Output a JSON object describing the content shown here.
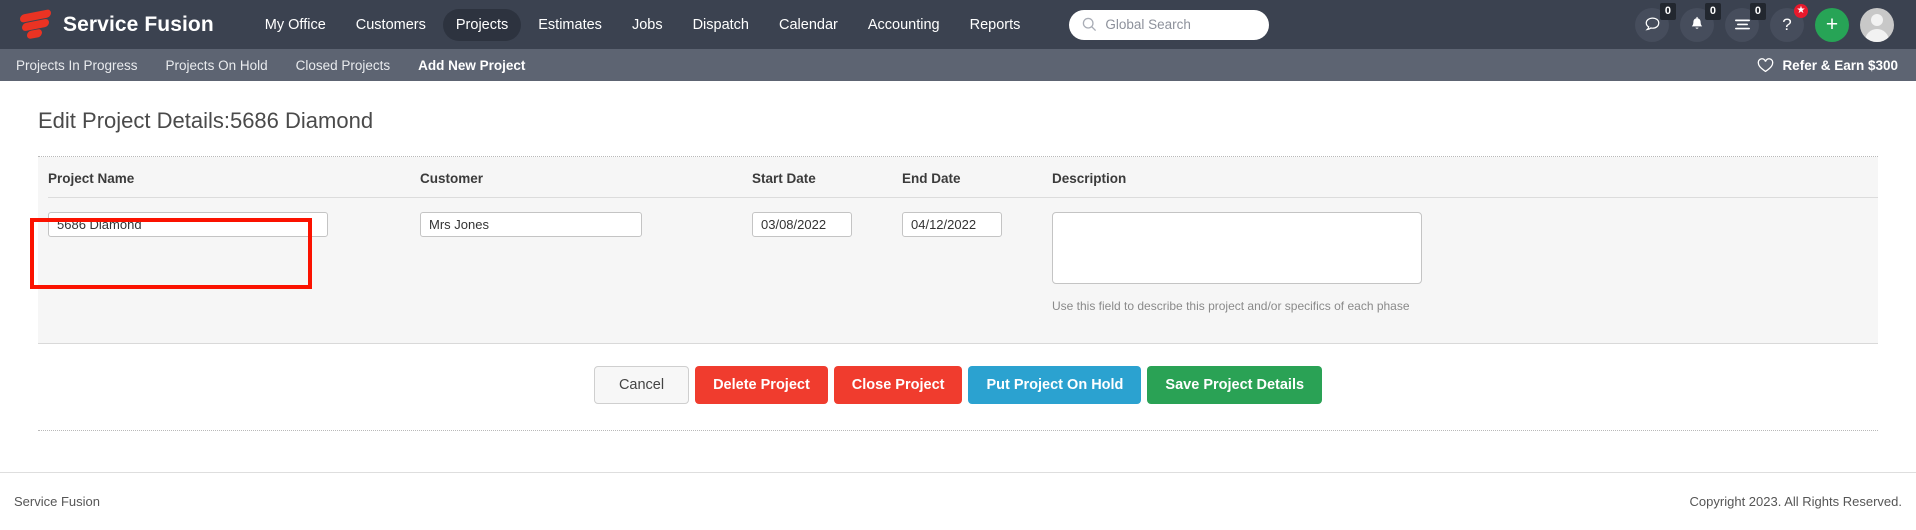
{
  "topbar": {
    "brand": "Service Fusion",
    "brand_logo_icon": "service-fusion-logo",
    "nav": [
      {
        "label": "My Office",
        "active": false
      },
      {
        "label": "Customers",
        "active": false
      },
      {
        "label": "Projects",
        "active": true
      },
      {
        "label": "Estimates",
        "active": false
      },
      {
        "label": "Jobs",
        "active": false
      },
      {
        "label": "Dispatch",
        "active": false
      },
      {
        "label": "Calendar",
        "active": false
      },
      {
        "label": "Accounting",
        "active": false
      },
      {
        "label": "Reports",
        "active": false
      }
    ],
    "search": {
      "placeholder": "Global Search",
      "value": ""
    },
    "icons": {
      "chat_badge": "0",
      "bell_badge": "0",
      "list_badge": "0",
      "help_label": "?",
      "plus_label": "+"
    }
  },
  "subbar": {
    "items": [
      {
        "label": "Projects In Progress",
        "active": false
      },
      {
        "label": "Projects On Hold",
        "active": false
      },
      {
        "label": "Closed Projects",
        "active": false
      },
      {
        "label": "Add New Project",
        "active": true
      }
    ],
    "refer_label": "Refer & Earn $300"
  },
  "main": {
    "page_title": "Edit Project Details:5686 Diamond",
    "fields": {
      "project_name": {
        "label": "Project Name",
        "value": "5686 Diamond",
        "placeholder": ""
      },
      "customer": {
        "label": "Customer",
        "value": "Mrs Jones",
        "placeholder": ""
      },
      "start_date": {
        "label": "Start Date",
        "value": "03/08/2022",
        "placeholder": ""
      },
      "end_date": {
        "label": "End Date",
        "value": "04/12/2022",
        "placeholder": ""
      },
      "description": {
        "label": "Description",
        "value": "",
        "placeholder": "",
        "hint": "Use this field to describe this project and/or specifics of each phase"
      }
    },
    "buttons": [
      {
        "label": "Cancel",
        "style": "cancel"
      },
      {
        "label": "Delete Project",
        "style": "red"
      },
      {
        "label": "Close Project",
        "style": "red"
      },
      {
        "label": "Put Project On Hold",
        "style": "blue"
      },
      {
        "label": "Save Project Details",
        "style": "green"
      }
    ]
  },
  "footer": {
    "left": "Service Fusion",
    "right": "Copyright 2023. All Rights Reserved."
  },
  "colors": {
    "topbar_bg": "#3b4250",
    "subbar_bg": "#5d6472",
    "brand_red": "#ea3323",
    "accent_green": "#27a456",
    "accent_blue": "#2ba2d0",
    "danger_red": "#f03c2e",
    "highlight_outline": "#fb1200",
    "card_bg": "#f6f6f6"
  }
}
